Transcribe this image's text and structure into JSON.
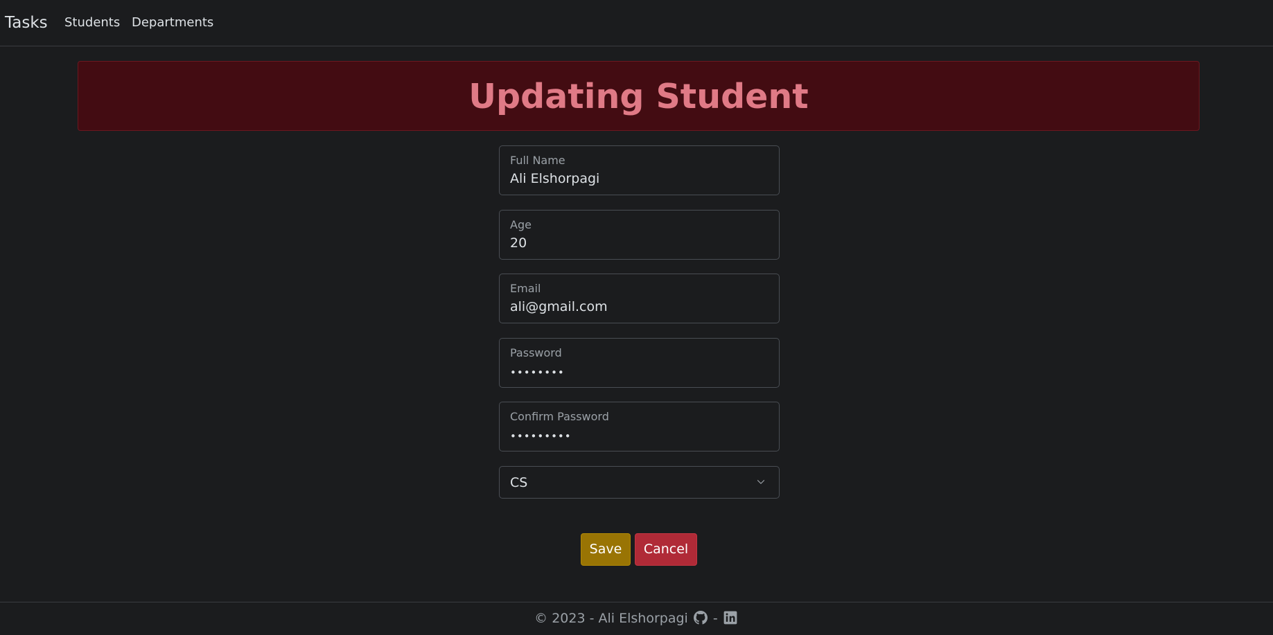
{
  "navbar": {
    "brand": "Tasks",
    "links": [
      "Students",
      "Departments"
    ]
  },
  "header": {
    "title": "Updating Student"
  },
  "form": {
    "full_name": {
      "label": "Full Name",
      "value": "Ali Elshorpagi"
    },
    "age": {
      "label": "Age",
      "value": "20"
    },
    "email": {
      "label": "Email",
      "value": "ali@gmail.com"
    },
    "password": {
      "label": "Password",
      "value": "••••••••"
    },
    "confirm_password": {
      "label": "Confirm Password",
      "value": "•••••••••"
    },
    "department": {
      "selected": "CS"
    }
  },
  "actions": {
    "save_label": "Save",
    "cancel_label": "Cancel"
  },
  "footer": {
    "text": "© 2023 - Ali Elshorpagi",
    "separator": "-",
    "icons": [
      "github-icon",
      "linkedin-icon"
    ]
  },
  "colors": {
    "background": "#1b1c1e",
    "alert_bg": "#430c12",
    "alert_text": "#e07a86",
    "save_button": "#997404",
    "cancel_button": "#b02a37"
  }
}
